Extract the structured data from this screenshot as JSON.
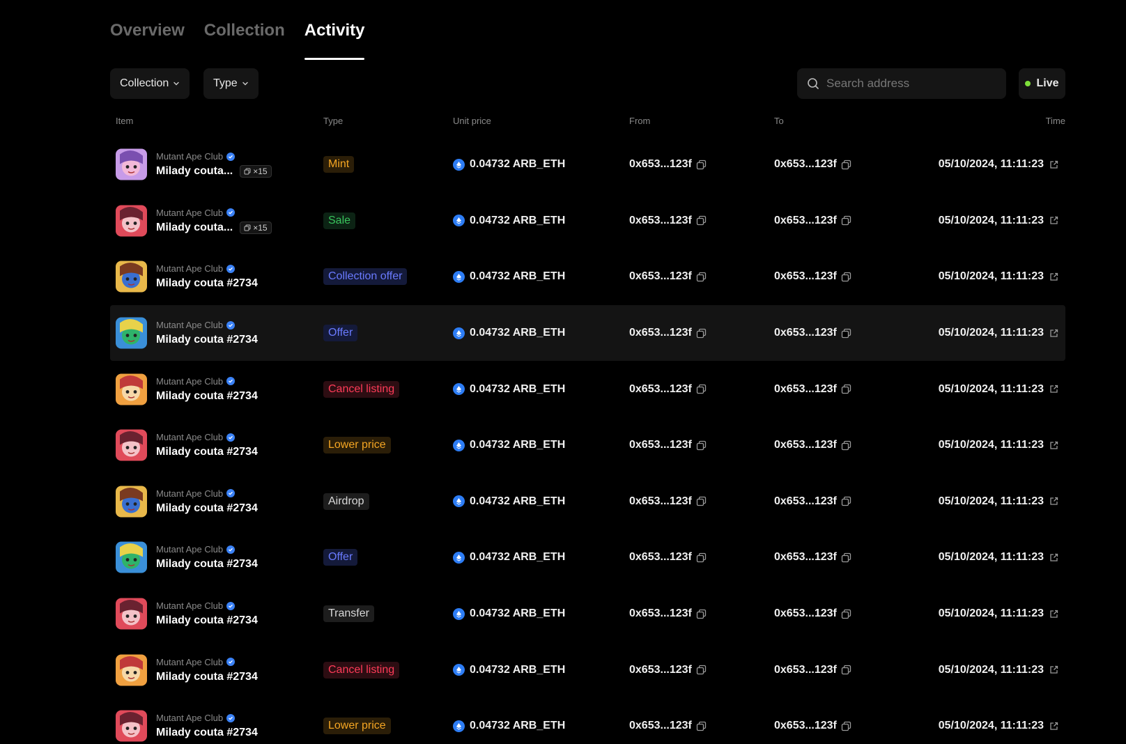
{
  "tabs": [
    {
      "label": "Overview",
      "active": false
    },
    {
      "label": "Collection",
      "active": false
    },
    {
      "label": "Activity",
      "active": true
    }
  ],
  "filters": {
    "collection_label": "Collection",
    "type_label": "Type",
    "search_placeholder": "Search address",
    "live_label": "Live"
  },
  "table": {
    "headers": {
      "item": "Item",
      "type": "Type",
      "unit_price": "Unit price",
      "from": "From",
      "to": "To",
      "time": "Time"
    },
    "rows": [
      {
        "collection": "Mutant Ape Club",
        "name": "Milady couta...",
        "qty": "×15",
        "type": "Mint",
        "type_style": "mint",
        "price": "0.04732 ARB_ETH",
        "from": "0x653...123f",
        "to": "0x653...123f",
        "time": "05/10/2024, 11:11:23",
        "thumb": "purple"
      },
      {
        "collection": "Mutant Ape Club",
        "name": "Milady couta...",
        "qty": "×15",
        "type": "Sale",
        "type_style": "sale",
        "price": "0.04732 ARB_ETH",
        "from": "0x653...123f",
        "to": "0x653...123f",
        "time": "05/10/2024, 11:11:23",
        "thumb": "red"
      },
      {
        "collection": "Mutant Ape Club",
        "name": "Milady couta  #2734",
        "qty": "",
        "type": "Collection offer",
        "type_style": "coll",
        "price": "0.04732 ARB_ETH",
        "from": "0x653...123f",
        "to": "0x653...123f",
        "time": "05/10/2024, 11:11:23",
        "thumb": "gold"
      },
      {
        "collection": "Mutant Ape Club",
        "name": "Milady couta  #2734",
        "qty": "",
        "type": "Offer",
        "type_style": "offer",
        "price": "0.04732 ARB_ETH",
        "from": "0x653...123f",
        "to": "0x653...123f",
        "time": "05/10/2024, 11:11:23",
        "thumb": "blue"
      },
      {
        "collection": "Mutant Ape Club",
        "name": "Milady couta  #2734",
        "qty": "",
        "type": "Cancel listing",
        "type_style": "cancel",
        "price": "0.04732 ARB_ETH",
        "from": "0x653...123f",
        "to": "0x653...123f",
        "time": "05/10/2024, 11:11:23",
        "thumb": "orange"
      },
      {
        "collection": "Mutant Ape Club",
        "name": "Milady couta  #2734",
        "qty": "",
        "type": "Lower price",
        "type_style": "lower",
        "price": "0.04732 ARB_ETH",
        "from": "0x653...123f",
        "to": "0x653...123f",
        "time": "05/10/2024, 11:11:23",
        "thumb": "red"
      },
      {
        "collection": "Mutant Ape Club",
        "name": "Milady couta  #2734",
        "qty": "",
        "type": "Airdrop",
        "type_style": "air",
        "price": "0.04732 ARB_ETH",
        "from": "0x653...123f",
        "to": "0x653...123f",
        "time": "05/10/2024, 11:11:23",
        "thumb": "gold"
      },
      {
        "collection": "Mutant Ape Club",
        "name": "Milady couta  #2734",
        "qty": "",
        "type": "Offer",
        "type_style": "offer",
        "price": "0.04732 ARB_ETH",
        "from": "0x653...123f",
        "to": "0x653...123f",
        "time": "05/10/2024, 11:11:23",
        "thumb": "blue"
      },
      {
        "collection": "Mutant Ape Club",
        "name": "Milady couta  #2734",
        "qty": "",
        "type": "Transfer",
        "type_style": "transfer",
        "price": "0.04732 ARB_ETH",
        "from": "0x653...123f",
        "to": "0x653...123f",
        "time": "05/10/2024, 11:11:23",
        "thumb": "red"
      },
      {
        "collection": "Mutant Ape Club",
        "name": "Milady couta  #2734",
        "qty": "",
        "type": "Cancel listing",
        "type_style": "cancel",
        "price": "0.04732 ARB_ETH",
        "from": "0x653...123f",
        "to": "0x653...123f",
        "time": "05/10/2024, 11:11:23",
        "thumb": "orange"
      },
      {
        "collection": "Mutant Ape Club",
        "name": "Milady couta  #2734",
        "qty": "",
        "type": "Lower price",
        "type_style": "lower",
        "price": "0.04732 ARB_ETH",
        "from": "0x653...123f",
        "to": "0x653...123f",
        "time": "05/10/2024, 11:11:23",
        "thumb": "red"
      }
    ]
  },
  "colors": {
    "live_dot": "#7ee03a",
    "arb_icon": "#2d7df5",
    "verified": "#3b82f6"
  }
}
